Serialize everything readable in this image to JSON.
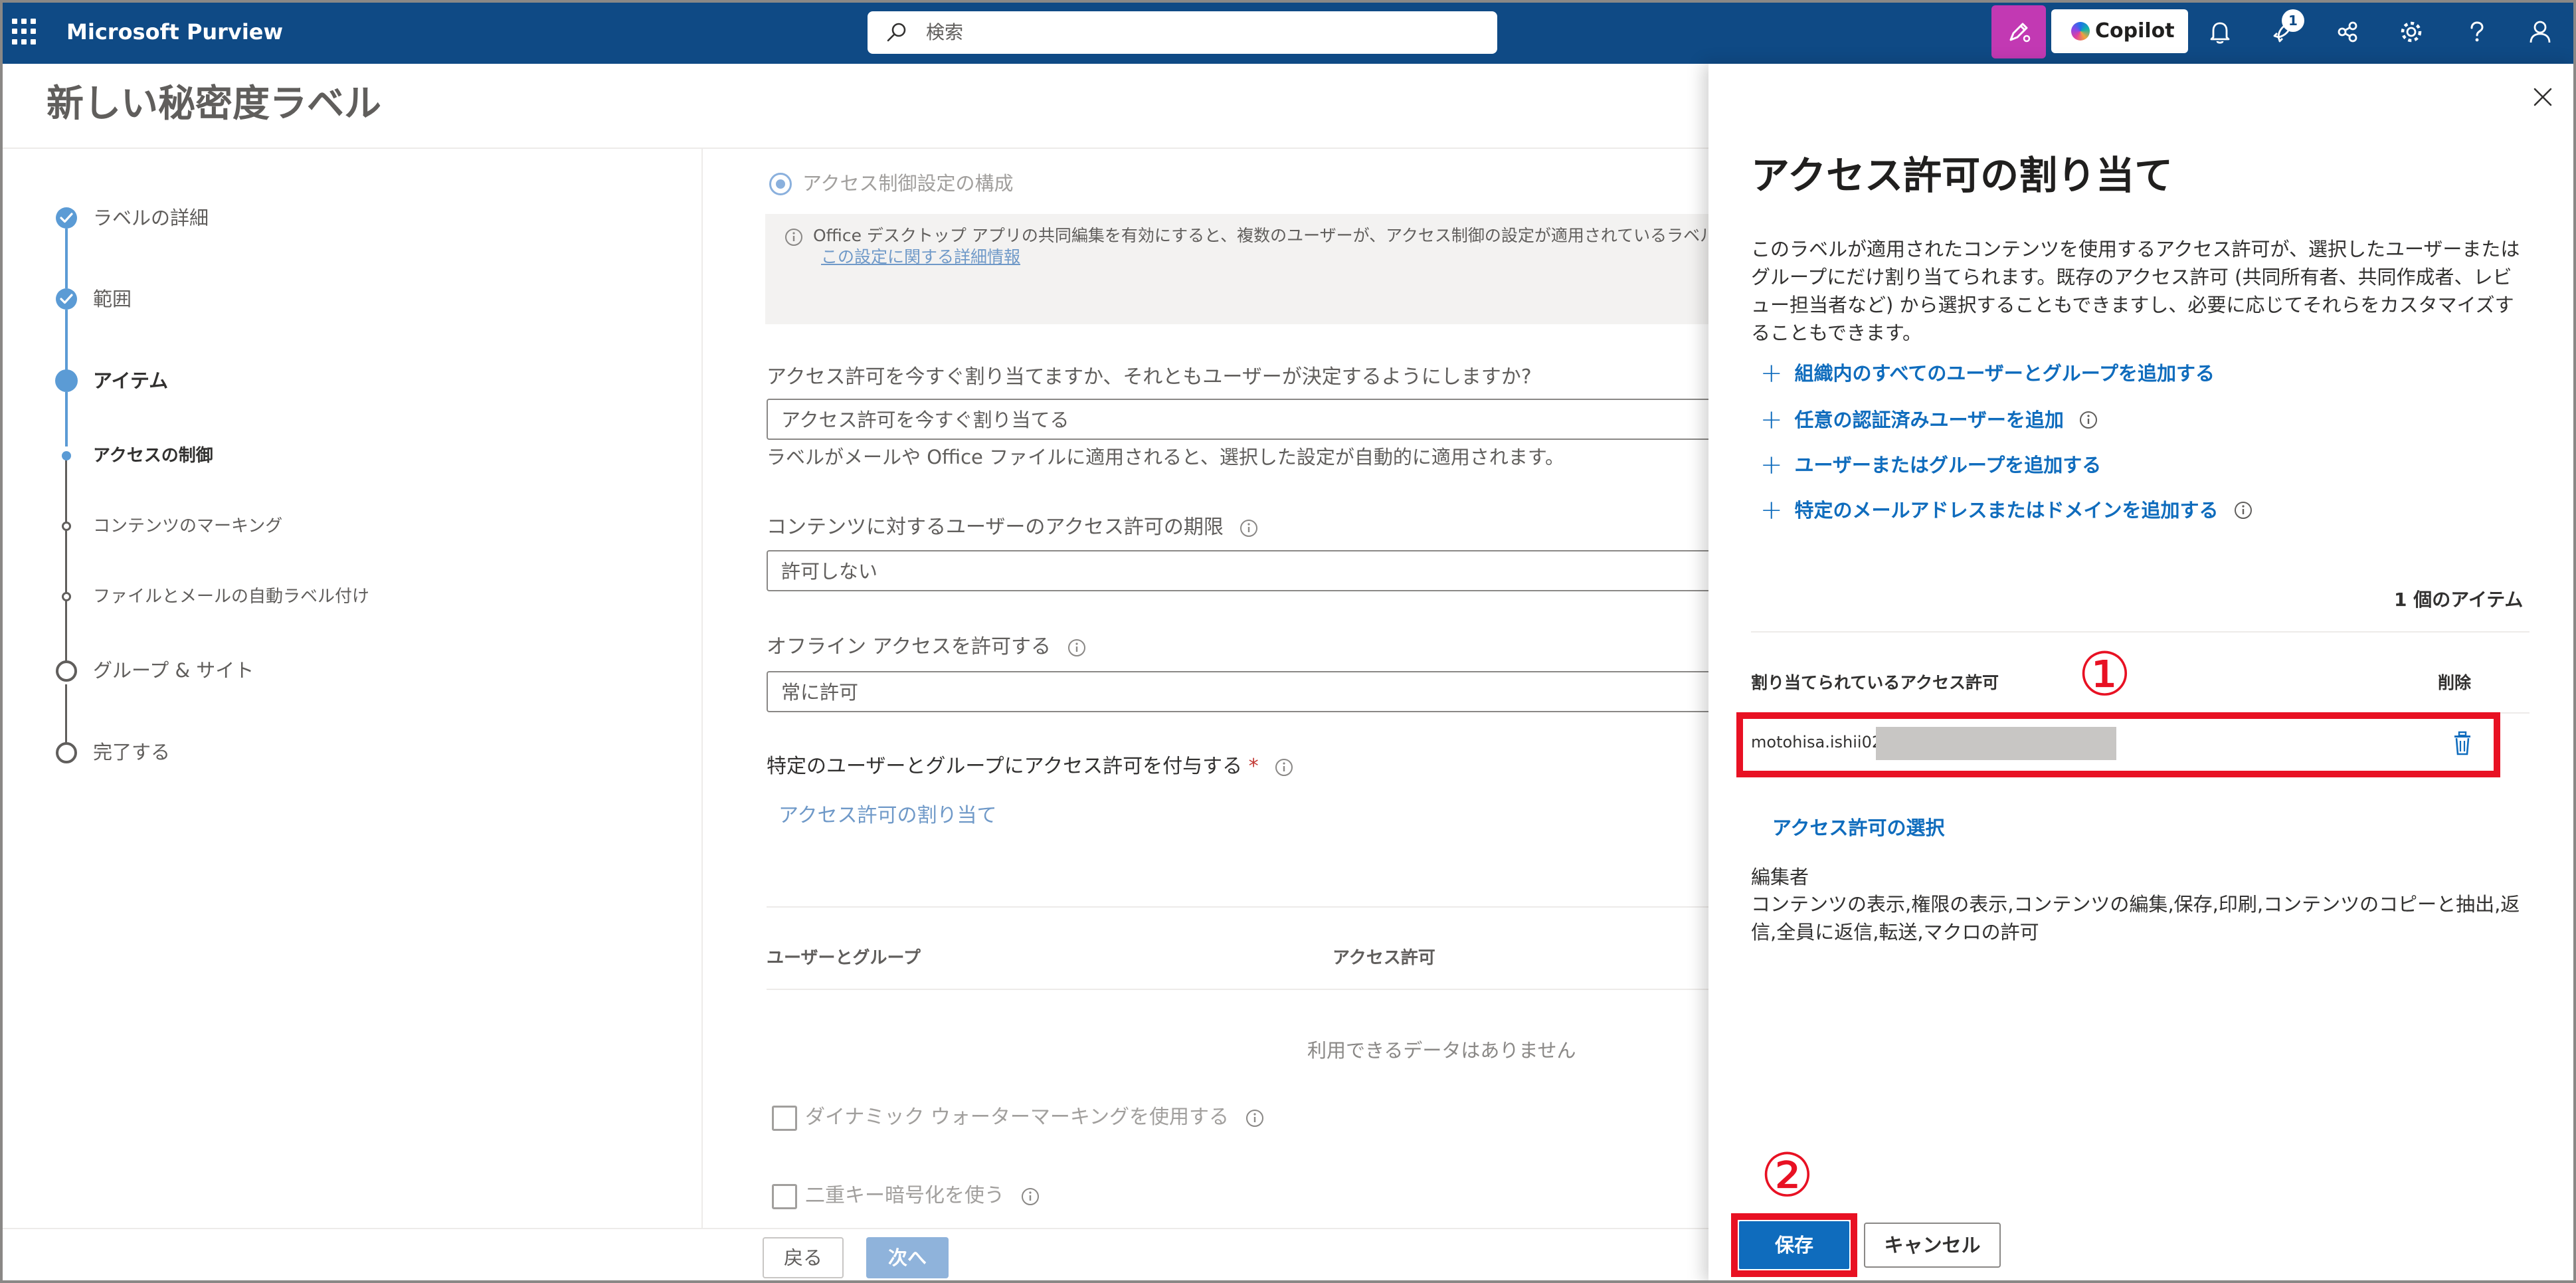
{
  "topbar": {
    "app_title": "Microsoft Purview",
    "search_placeholder": "検索",
    "copilot_label": "Copilot",
    "notification_badge": "1",
    "icons": [
      "waffle-icon",
      "search-icon",
      "pen-icon",
      "bell-icon",
      "rocket-icon",
      "share-icon",
      "gear-icon",
      "help-icon",
      "person-icon"
    ]
  },
  "page": {
    "title": "新しい秘密度ラベル"
  },
  "steps": [
    {
      "label": "ラベルの詳細",
      "state": "done"
    },
    {
      "label": "範囲",
      "state": "done"
    },
    {
      "label": "アイテム",
      "state": "current"
    },
    {
      "label": "アクセスの制御",
      "state": "current-sub"
    },
    {
      "label": "コンテンツのマーキング",
      "state": "pending-sub"
    },
    {
      "label": "ファイルとメールの自動ラベル付け",
      "state": "pending-sub"
    },
    {
      "label": "グループ & サイト",
      "state": "pending"
    },
    {
      "label": "完了する",
      "state": "pending"
    }
  ],
  "form": {
    "radio_label": "アクセス制御設定の構成",
    "info_text": "Office デスクトップ アプリの共同編集を有効にすると、複数のユーザーが、アクセス制御の設定が適用されているラベル付",
    "info_link": "この設定に関する詳細情報",
    "assign_question": "アクセス許可を今すぐ割り当てますか、それともユーザーが決定するようにしますか?",
    "assign_value": "アクセス許可を今すぐ割り当てる",
    "assign_desc": "ラベルがメールや Office ファイルに適用されると、選択した設定が自動的に適用されます。",
    "expire_label": "コンテンツに対するユーザーのアクセス許可の期限",
    "expire_value": "許可しない",
    "offline_label": "オフライン アクセスを許可する",
    "offline_value": "常に許可",
    "grant_label": "特定のユーザーとグループにアクセス許可を付与する",
    "required_mark": "*",
    "assign_link": "アクセス許可の割り当て",
    "col_users": "ユーザーとグループ",
    "col_perms": "アクセス許可",
    "empty_msg": "利用できるデータはありません",
    "watermark_label": "ダイナミック ウォーターマーキングを使用する",
    "double_key_label": "二重キー暗号化を使う",
    "back_label": "戻る",
    "next_label": "次へ"
  },
  "panel": {
    "title": "アクセス許可の割り当て",
    "description": "このラベルが適用されたコンテンツを使用するアクセス許可が、選択したユーザーまたはグループにだけ割り当てられます。既存のアクセス許可 (共同所有者、共同作成者、レビュー担当者など) から選択することもできますし、必要に応じてそれらをカスタマイズすることもできます。",
    "add_actions": [
      "組織内のすべてのユーザーとグループを追加する",
      "任意の認証済みユーザーを追加",
      "ユーザーまたはグループを追加する",
      "特定のメールアドレスまたはドメインを追加する"
    ],
    "item_count": "1 個のアイテム",
    "col_assigned": "割り当てられているアクセス許可",
    "col_delete": "削除",
    "user_email": "motohisa.ishii02@",
    "perm_link": "アクセス許可の選択",
    "role": "編集者",
    "role_desc": "コンテンツの表示,権限の表示,コンテンツの編集,保存,印刷,コンテンツのコピーと抽出,返信,全員に返信,転送,マクロの許可",
    "save_label": "保存",
    "cancel_label": "キャンセル"
  },
  "annotations": {
    "marker_1": "①",
    "marker_2": "②",
    "color": "#e81123"
  },
  "colors": {
    "topbar": "#0f4a85",
    "accent": "#0f6cbd",
    "copilot_pink": "#c239b3"
  }
}
